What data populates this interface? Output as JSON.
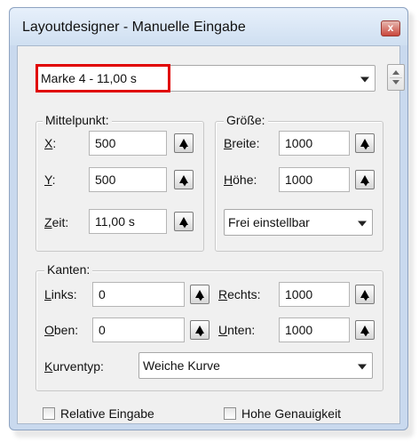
{
  "window": {
    "title": "Layoutdesigner - Manuelle Eingabe",
    "close_glyph": "x"
  },
  "marker_select": {
    "value": "Marke 4 - 11,00 s",
    "icon": "chevron-down-icon"
  },
  "mittelpunkt": {
    "title": "Mittelpunkt:",
    "x_label_ul": "X",
    "x_label_rest": ":",
    "x_value": "500",
    "y_label_ul": "Y",
    "y_label_rest": ":",
    "y_value": "500",
    "zeit_label_ul": "Z",
    "zeit_label_rest": "eit:",
    "zeit_value": "11,00 s"
  },
  "groesse": {
    "title": "Größe:",
    "breite_label_ul": "B",
    "breite_label_rest": "reite:",
    "breite_value": "1000",
    "hoehe_label_ul": "H",
    "hoehe_label_rest": "öhe:",
    "hoehe_value": "1000",
    "mode_select": "Frei einstellbar"
  },
  "kanten": {
    "title": "Kanten:",
    "links_label_ul": "L",
    "links_label_rest": "inks:",
    "links_value": "0",
    "rechts_label_ul": "R",
    "rechts_label_rest": "echts:",
    "rechts_value": "1000",
    "oben_label_ul": "O",
    "oben_label_rest": "ben:",
    "oben_value": "0",
    "unten_label_ul": "U",
    "unten_label_rest": "nten:",
    "unten_value": "1000",
    "kurventyp_label_ul": "K",
    "kurventyp_label_rest": "urventyp:",
    "kurventyp_value": "Weiche Kurve"
  },
  "options": {
    "relative_label": "Relative Eingabe",
    "relative_checked": false,
    "precision_label": "Hohe Genauigkeit",
    "precision_checked": false
  },
  "colors": {
    "highlight": "#e00000",
    "window_frame": "#c9d9ee",
    "client_bg": "#f0f0f0"
  }
}
